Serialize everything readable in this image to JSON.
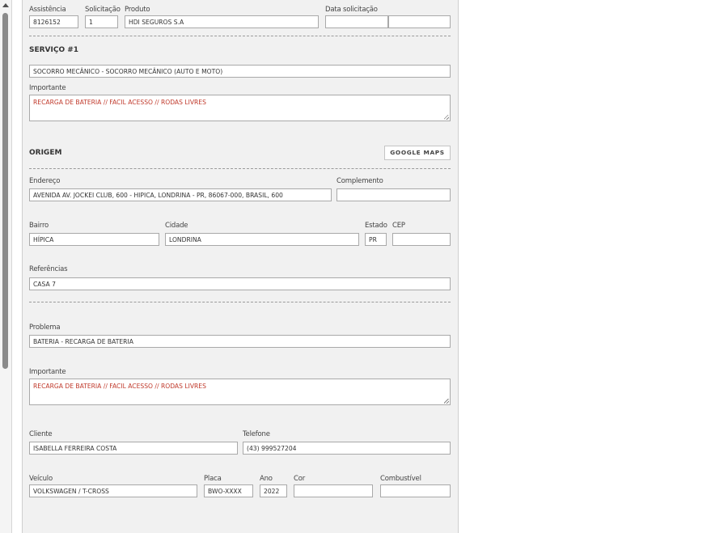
{
  "labels": {
    "assistencia": "Assistência",
    "solicitacao": "Solicitação",
    "produto": "Produto",
    "data_solicitacao": "Data solicitação",
    "importante": "Importante",
    "endereco": "Endereço",
    "complemento": "Complemento",
    "bairro": "Bairro",
    "cidade": "Cidade",
    "estado": "Estado",
    "cep": "CEP",
    "referencias": "Referências",
    "problema": "Problema",
    "cliente": "Cliente",
    "telefone": "Telefone",
    "veiculo": "Veículo",
    "placa": "Placa",
    "ano": "Ano",
    "cor": "Cor",
    "combustivel": "Combustível"
  },
  "header": {
    "assistencia": "8126152",
    "solicitacao": "1",
    "produto": "HDI SEGUROS S.A",
    "data_solicitacao_date": "",
    "data_solicitacao_time": ""
  },
  "servico": {
    "title": "SERVIÇO #1",
    "description": "SOCORRO MECÂNICO - SOCORRO MECÂNICO (AUTO E MOTO)",
    "importante": "RECARGA DE BATERIA // FACIL ACESSO // RODAS LIVRES"
  },
  "origem": {
    "title": "ORIGEM",
    "maps_button": "GOOGLE MAPS",
    "endereco": "AVENIDA AV. JOCKEI CLUB, 600 - HIPICA, LONDRINA - PR, 86067-000, BRASIL, 600",
    "complemento": "",
    "bairro": "HÍPICA",
    "cidade": "LONDRINA",
    "estado": "PR",
    "cep": "",
    "referencias": "CASA 7"
  },
  "problema": {
    "value": "BATERIA - RECARGA DE BATERIA",
    "importante": "RECARGA DE BATERIA // FACIL ACESSO // RODAS LIVRES"
  },
  "cliente": {
    "nome": "ISABELLA FERREIRA COSTA",
    "telefone": "(43) 999527204"
  },
  "veiculo": {
    "modelo": "VOLKSWAGEN / T-CROSS",
    "placa": "BWO-XXXX",
    "ano": "2022",
    "cor": "",
    "combustivel": ""
  },
  "colors": {
    "panel": "#f1f1f1",
    "important_text": "#c0392b",
    "border": "#a9a9a9"
  }
}
